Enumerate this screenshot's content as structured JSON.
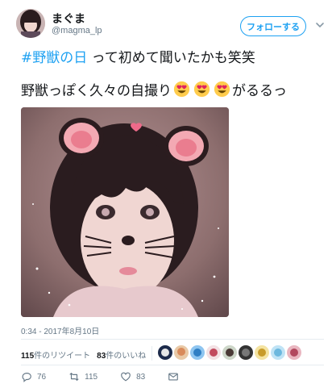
{
  "user": {
    "display_name": "まぐま",
    "handle": "@magma_lp",
    "follow_label": "フォローする"
  },
  "tweet": {
    "hashtag": "#野獣の日",
    "line1_rest": " って初めて聞いたかも笑笑",
    "line2_text": "野獣っぽく久々の自撮り",
    "line2_suffix": "がるるっ",
    "emoji_name": "smiling-face-with-heart-eyes",
    "timestamp": "0:34 - 2017年8月10日"
  },
  "stats": {
    "retweets_count": "115",
    "retweets_label": "件のリツイート",
    "likes_count": "83",
    "likes_label": "件のいいね"
  },
  "actions": {
    "reply_count": "76",
    "retweet_count": "115",
    "like_count": "83"
  },
  "colors": {
    "accent": "#1da1f2",
    "muted": "#657786",
    "like": "#e0245e"
  }
}
